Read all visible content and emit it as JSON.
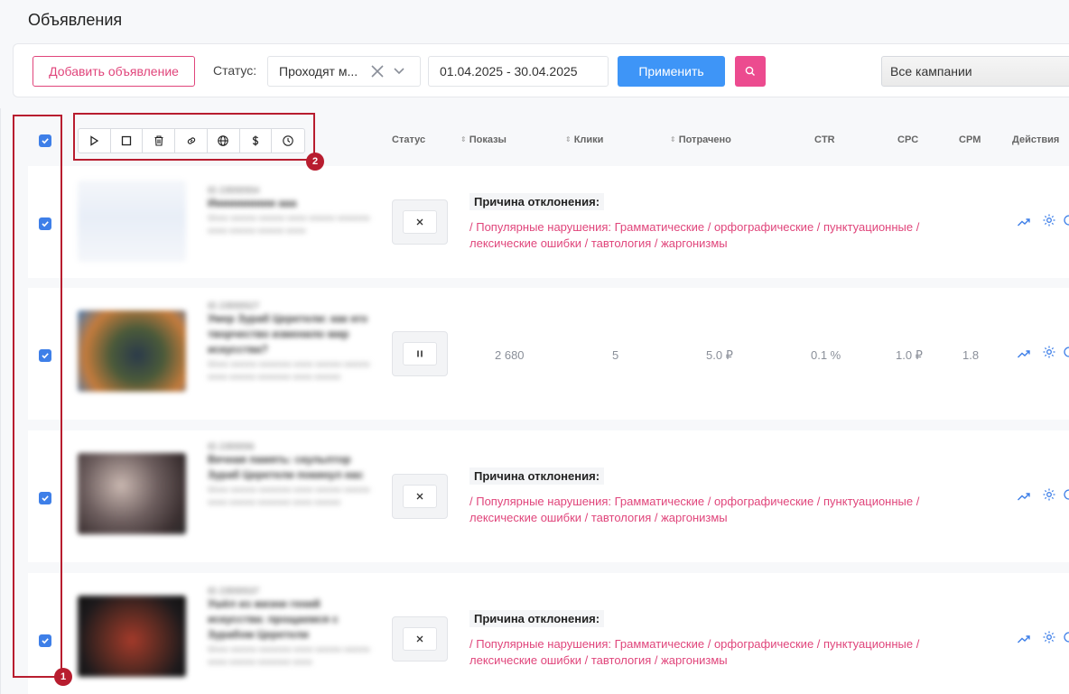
{
  "page": {
    "title": "Объявления"
  },
  "filters": {
    "add_button": "Добавить объявление",
    "status_label": "Статус:",
    "status_value": "Проходят м...",
    "date_range": "01.04.2025 - 30.04.2025",
    "apply_button": "Применить",
    "campaign_select": "Все кампании"
  },
  "table": {
    "headers": {
      "status": "Статус",
      "impressions": "Показы",
      "clicks": "Клики",
      "spent": "Потрачено",
      "ctr": "CTR",
      "cpc": "CPC",
      "cpm": "CPM",
      "actions": "Действия"
    },
    "toolbar_icons": [
      "play-icon",
      "stop-icon",
      "trash-icon",
      "link-icon",
      "globe-icon",
      "dollar-icon",
      "clock-icon"
    ],
    "rows": [
      {
        "checked": true,
        "status_icon": "close-icon",
        "reject_title": "Причина отклонения:",
        "reject_text": "/ Популярные нарушения: Грамматические / орфографические / пунктуационные / лексические ошибки / тавтология / жаргонизмы"
      },
      {
        "checked": true,
        "status_icon": "pause-icon",
        "impressions": "2 680",
        "clicks": "5",
        "spent": "5.0 ₽",
        "ctr": "0.1 %",
        "cpc": "1.0 ₽",
        "cpm": "1.8"
      },
      {
        "checked": true,
        "status_icon": "close-icon",
        "reject_title": "Причина отклонения:",
        "reject_text": "/ Популярные нарушения: Грамматические / орфографические / пунктуационные / лексические ошибки / тавтология / жаргонизмы"
      },
      {
        "checked": true,
        "status_icon": "close-icon",
        "reject_title": "Причина отклонения:",
        "reject_text": "/ Популярные нарушения: Грамматические / орфографические / пунктуационные / лексические ошибки / тавтология / жаргонизмы"
      }
    ]
  },
  "annotations": {
    "badge_1": "1",
    "badge_2": "2"
  },
  "colors": {
    "accent_pink": "#e0457b",
    "primary_blue": "#3e95f7",
    "annotation_red": "#b81d2f"
  }
}
